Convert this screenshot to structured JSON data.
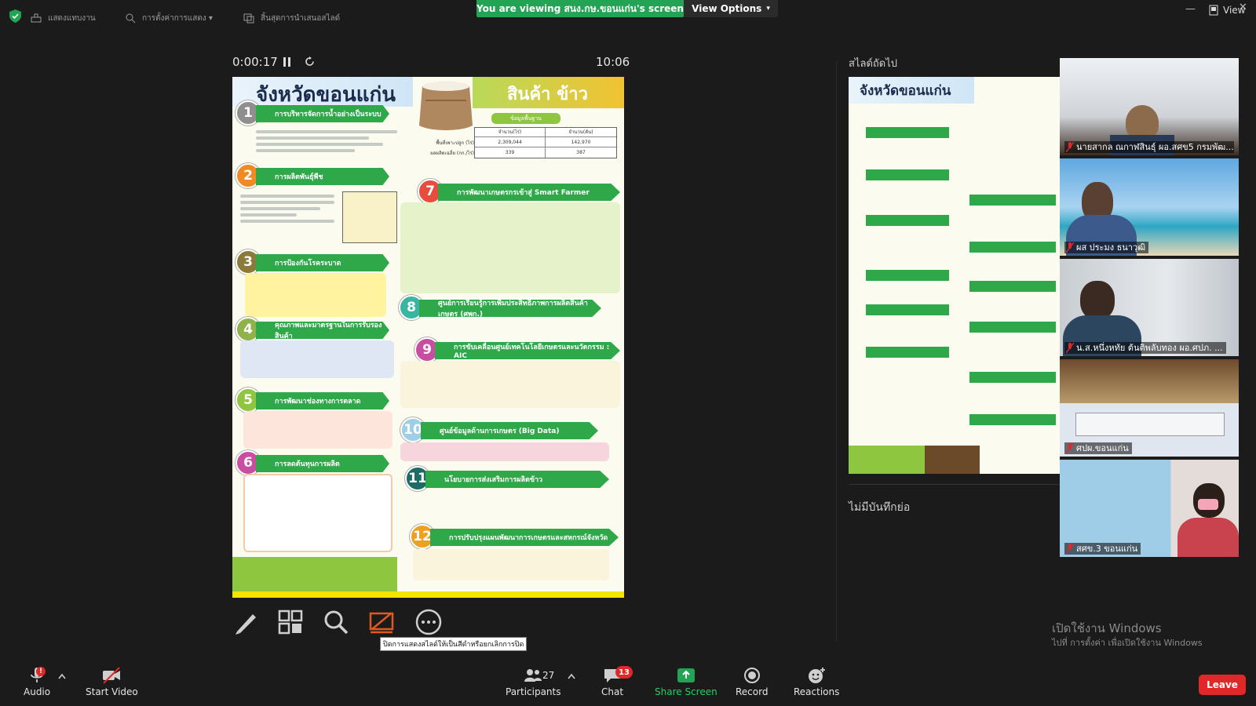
{
  "topbar": {
    "items": [
      {
        "label": "แสดงแทบงาน"
      },
      {
        "label": "การตั้งค่าการแสดง ▾"
      },
      {
        "label": "สิ้นสุดการนำเสนอสไลด์"
      }
    ],
    "banner": "You are viewing สนง.กษ.ขอนแก่น's screen",
    "view_options": "View Options",
    "view_label": "View"
  },
  "presenter": {
    "elapsed": "0:00:17",
    "clock": "10:06",
    "tooltip": "ปิดการแสดงสไลด์ให้เป็นสีดำหรือยกเลิกการปิด"
  },
  "slide": {
    "title": "จังหวัดขอนแก่น",
    "product": "สินค้า ข้าว",
    "sections": [
      {
        "num": "1",
        "title": "การบริหารจัดการน้ำอย่างเป็นระบบ"
      },
      {
        "num": "2",
        "title": "การผลิตพันธุ์พืช"
      },
      {
        "num": "3",
        "title": "การป้องกันโรคระบาด"
      },
      {
        "num": "4",
        "title": "คุณภาพและมาตรฐานในการรับรองสินค้า"
      },
      {
        "num": "5",
        "title": "การพัฒนาช่องทางการตลาด"
      },
      {
        "num": "6",
        "title": "การลดต้นทุนการผลิต"
      },
      {
        "num": "7",
        "title": "การพัฒนาเกษตรกรเข้าสู่ Smart Farmer"
      },
      {
        "num": "8",
        "title": "ศูนย์การเรียนรู้การเพิ่มประสิทธิภาพการผลิตสินค้าเกษตร (ศพก.)"
      },
      {
        "num": "9",
        "title": "การขับเคลื่อนศูนย์เทคโนโลยีเกษตรและนวัตกรรม : AIC"
      },
      {
        "num": "10",
        "title": "ศูนย์ข้อมูลด้านการเกษตร (Big Data)"
      },
      {
        "num": "11",
        "title": "นโยบายการส่งเสริมการผลิตข้าว"
      },
      {
        "num": "12",
        "title": "การปรับปรุงแผนพัฒนาการเกษตรและสหกรณ์จังหวัด"
      }
    ],
    "info_title": "ข้อมูลพื้นฐาน",
    "table_headers": [
      "จำนวน(ไร่)",
      "จำนวน(ตัน)"
    ],
    "row_labels": [
      "พื้นที่เพาะปลูก (ไร่)",
      "ผลผลิตเฉลี่ย (กก./ไร่)"
    ],
    "cells": [
      [
        "2,309,044",
        "142,970"
      ],
      [
        "339",
        "387"
      ]
    ]
  },
  "next": {
    "label": "สไลด์ถัดไป",
    "title": "จังหวัดขอนแก่น",
    "notes": "ไม่มีบันทึกย่อ"
  },
  "participants_video": [
    {
      "name": "นายสากล ณกาฬสินธุ์ ผอ.สศข5 กรมพัฒ..."
    },
    {
      "name": "ผส ประมง ธนาวุฒิ"
    },
    {
      "name": "น.ส.หนึ่งหทัย ต้นติพลับทอง ผอ.ศปภ. ..."
    },
    {
      "name": "ศปผ.ขอนแก่น"
    },
    {
      "name": "สศข.3 ขอนแก่น"
    }
  ],
  "watermark": {
    "line1": "เปิดใช้งาน Windows",
    "line2": "ไปที่ การตั้งค่า เพื่อเปิดใช้งาน Windows"
  },
  "toolbar": {
    "audio": "Audio",
    "start_video": "Start Video",
    "participants": "Participants",
    "participants_count": "27",
    "chat": "Chat",
    "chat_badge": "13",
    "share": "Share Screen",
    "record": "Record",
    "reactions": "Reactions",
    "leave": "Leave"
  },
  "colors": {
    "share_green": "#23a455",
    "leave_red": "#e02828",
    "badge_red": "#e02828"
  }
}
